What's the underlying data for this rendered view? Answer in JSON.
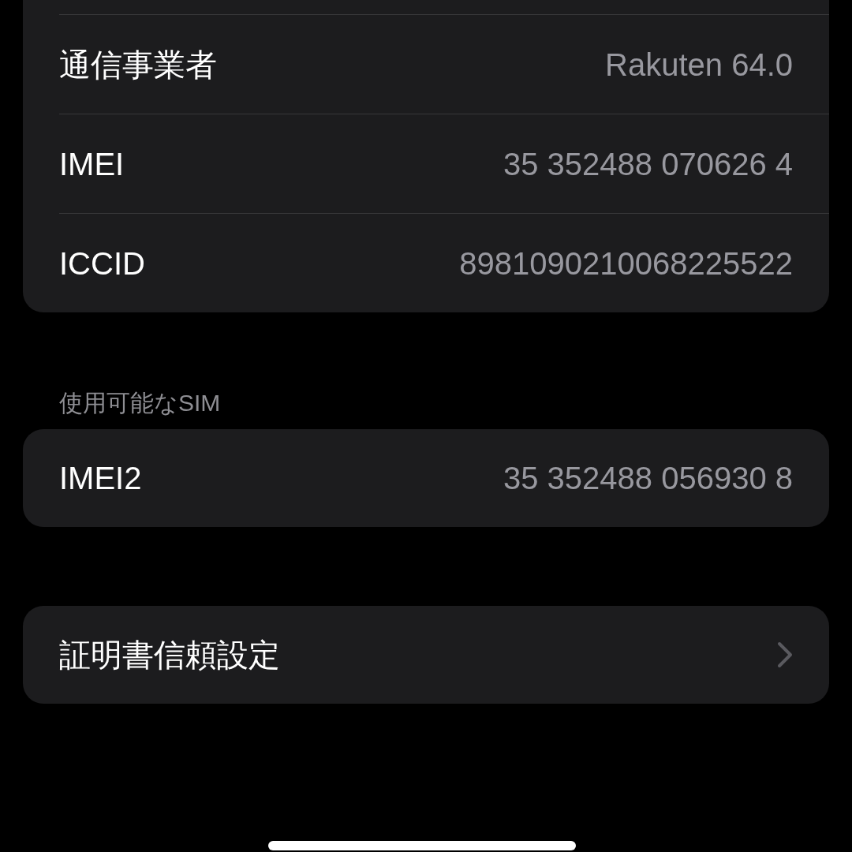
{
  "groups": [
    {
      "cut_off_top": true,
      "rows": [
        {
          "kind": "value",
          "label": "通信事業者",
          "value": "Rakuten 64.0"
        },
        {
          "kind": "value",
          "label": "IMEI",
          "value": "35 352488 070626 4"
        },
        {
          "kind": "value",
          "label": "ICCID",
          "value": "8981090210068225522"
        }
      ]
    },
    {
      "cut_off_top": false,
      "header": "使用可能なSIM",
      "rows": [
        {
          "kind": "value",
          "label": "IMEI2",
          "value": "35 352488 056930 8"
        }
      ]
    },
    {
      "cut_off_top": false,
      "rows": [
        {
          "kind": "link",
          "label": "証明書信頼設定"
        }
      ]
    }
  ]
}
